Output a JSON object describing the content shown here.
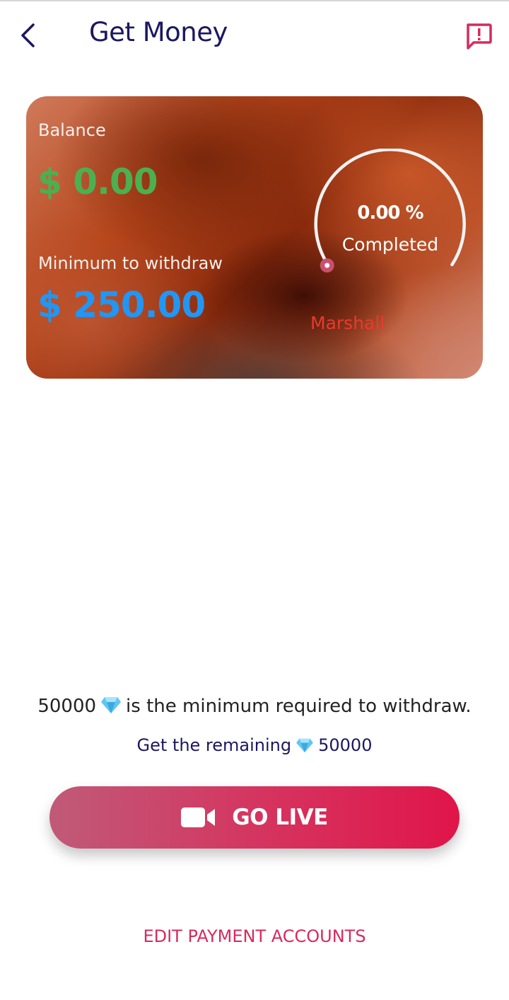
{
  "header": {
    "title": "Get Money",
    "back_icon": "chevron-left-icon",
    "report_icon": "report-icon"
  },
  "card": {
    "balance_label": "Balance",
    "balance_value": "$ 0.00",
    "min_label": "Minimum to withdraw",
    "min_value": "$ 250.00",
    "progress_percent": "0.00 %",
    "progress_label": "Completed",
    "progress_fraction": 0,
    "name": "Marshall"
  },
  "info": {
    "min_amount": "50000",
    "min_text": "is the minimum required to withdraw.",
    "remaining_prefix": "Get the remaining",
    "remaining_amount": "50000",
    "gem_icon": "diamond-icon"
  },
  "actions": {
    "go_live_label": "GO LIVE",
    "go_live_icon": "video-camera-icon",
    "edit_accounts_label": "EDIT PAYMENT ACCOUNTS"
  },
  "colors": {
    "title": "#1c1760",
    "balance": "#4caf50",
    "minimum": "#2196f3",
    "accent": "#e0154a",
    "link": "#d52b5d"
  }
}
